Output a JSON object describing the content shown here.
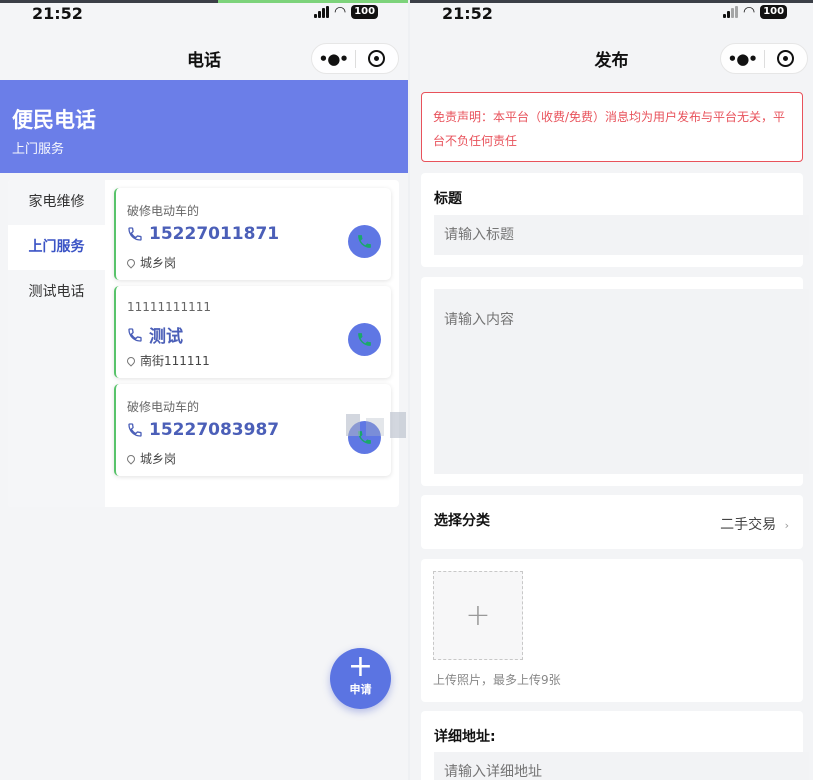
{
  "status": {
    "time": "21:52",
    "battery": "100"
  },
  "left": {
    "nav": {
      "title": "电话"
    },
    "banner": {
      "title": "便民电话",
      "subtitle": "上门服务"
    },
    "categories": [
      {
        "label": "家电维修"
      },
      {
        "label": "上门服务"
      },
      {
        "label": "测试电话"
      }
    ],
    "active_category": "上门服务",
    "contacts": [
      {
        "title": "破修电动车的",
        "name": "15227011871",
        "location": "城乡岗"
      },
      {
        "title": "11111111111",
        "name": "测试",
        "location": "南街111111"
      },
      {
        "title": "破修电动车的",
        "name": "15227083987",
        "location": "城乡岗"
      }
    ],
    "fab": {
      "label": "申请"
    }
  },
  "right": {
    "nav": {
      "title": "发布"
    },
    "notice": "免责声明：本平台（收费/免费）消息均为用户发布与平台无关，平台不负任何责任",
    "title_label": "标题",
    "title_placeholder": "请输入标题",
    "content_placeholder": "请输入内容",
    "category_label": "选择分类",
    "category_value": "二手交易",
    "upload_hint": "上传照片，最多上传9张",
    "address_label": "详细地址:",
    "address_placeholder": "请输入详细地址"
  },
  "colors": {
    "accent": "#6b7ee8",
    "card_border": "#58c36a",
    "call_icon": "#1aa86b",
    "notice": "#e8525b"
  },
  "icons": [
    "phone-icon",
    "location-pin-icon",
    "more-icon",
    "capsule-close-icon",
    "plus-icon",
    "chevron-right-icon",
    "wifi-icon",
    "signal-icon",
    "battery-icon"
  ]
}
